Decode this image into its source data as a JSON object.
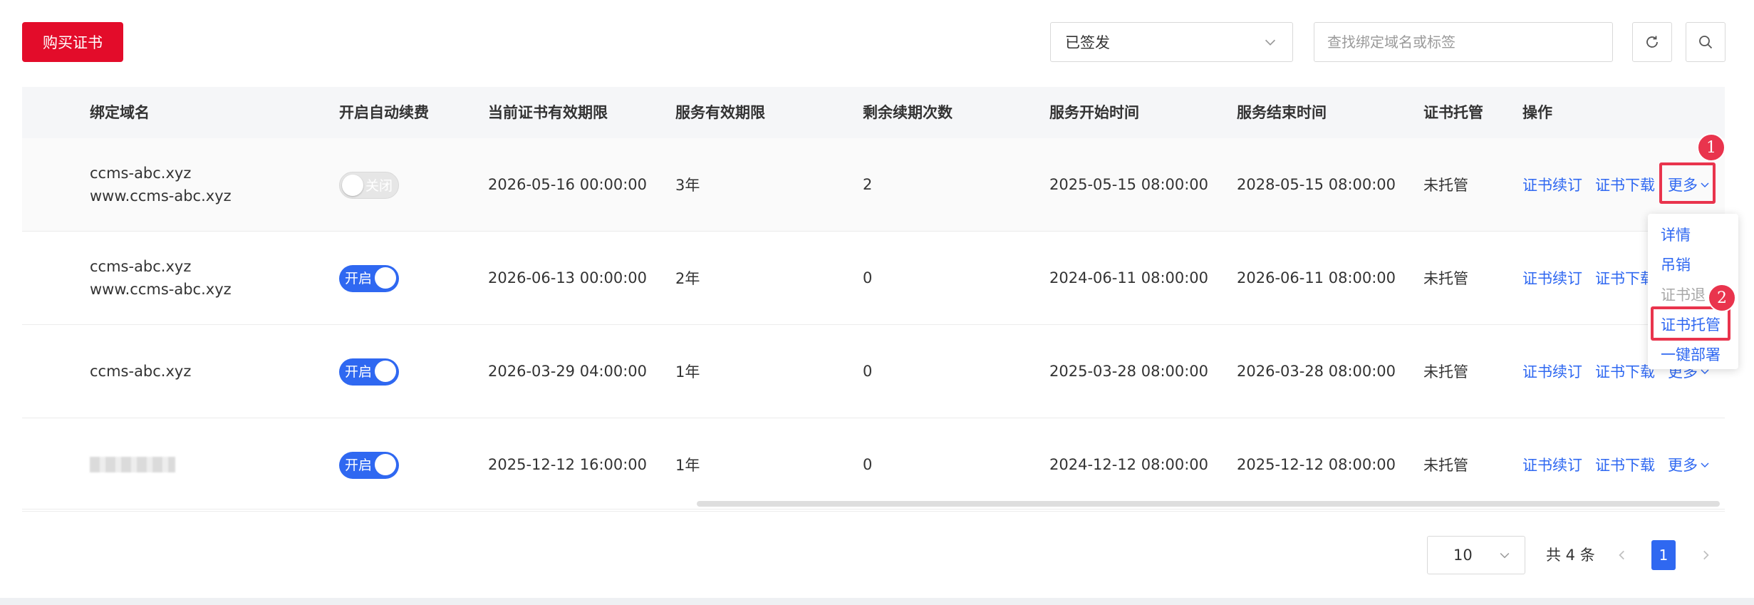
{
  "toolbar": {
    "buy_label": "购买证书",
    "status_value": "已签发",
    "search_placeholder": "查找绑定域名或标签"
  },
  "table": {
    "headers": [
      "绑定域名",
      "开启自动续费",
      "当前证书有效期限",
      "服务有效期限",
      "剩余续期次数",
      "服务开始时间",
      "服务结束时间",
      "证书托管",
      "操作"
    ],
    "rows": [
      {
        "domain1": "ccms-abc.xyz",
        "domain2": "www.ccms-abc.xyz",
        "auto_renew": "关闭",
        "auto_renew_on": false,
        "cert_validity": "2026-05-16 00:00:00",
        "service_period": "3年",
        "renewals_left": "2",
        "start": "2025-05-15 08:00:00",
        "end": "2028-05-15 08:00:00",
        "hosting": "未托管",
        "act_renew": "证书续订",
        "act_download": "证书下载",
        "act_more": "更多"
      },
      {
        "domain1": "ccms-abc.xyz",
        "domain2": "www.ccms-abc.xyz",
        "auto_renew": "开启",
        "auto_renew_on": true,
        "cert_validity": "2026-06-13 00:00:00",
        "service_period": "2年",
        "renewals_left": "0",
        "start": "2024-06-11 08:00:00",
        "end": "2026-06-11 08:00:00",
        "hosting": "未托管",
        "act_renew": "证书续订",
        "act_download": "证书下载",
        "act_more": "更多"
      },
      {
        "domain1": "ccms-abc.xyz",
        "domain2": "",
        "auto_renew": "开启",
        "auto_renew_on": true,
        "cert_validity": "2026-03-29 04:00:00",
        "service_period": "1年",
        "renewals_left": "0",
        "start": "2025-03-28 08:00:00",
        "end": "2026-03-28 08:00:00",
        "hosting": "未托管",
        "act_renew": "证书续订",
        "act_download": "证书下载",
        "act_more": "更多"
      },
      {
        "domain1": "",
        "domain2": "",
        "auto_renew": "开启",
        "auto_renew_on": true,
        "cert_validity": "2025-12-12 16:00:00",
        "service_period": "1年",
        "renewals_left": "0",
        "start": "2024-12-12 08:00:00",
        "end": "2025-12-12 08:00:00",
        "hosting": "未托管",
        "act_renew": "证书续订",
        "act_download": "证书下载",
        "act_more": "更多"
      }
    ]
  },
  "more_menu": {
    "items": [
      "详情",
      "吊销",
      "证书退",
      "证书托管",
      "一键部署"
    ]
  },
  "annotations": {
    "badge1": "1",
    "badge2": "2"
  },
  "pagination": {
    "page_size": "10",
    "total": "共 4 条",
    "current_page": "1"
  },
  "colors": {
    "accent_red": "#e30c2a",
    "primary_blue": "#2f68f1",
    "highlight_red": "#e9344d"
  }
}
